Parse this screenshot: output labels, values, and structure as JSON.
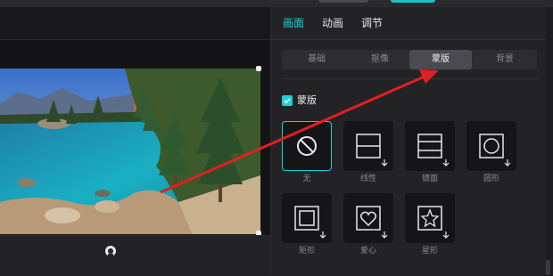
{
  "tabs": [
    {
      "label": "画面",
      "active": true
    },
    {
      "label": "动画",
      "active": false
    },
    {
      "label": "调节",
      "active": false
    }
  ],
  "subtabs": [
    {
      "label": "基础",
      "active": false
    },
    {
      "label": "抠像",
      "active": false
    },
    {
      "label": "蒙版",
      "active": true
    },
    {
      "label": "背景",
      "active": false
    }
  ],
  "mask_section": {
    "label": "蒙版",
    "checked": true
  },
  "masks": [
    {
      "label": "无",
      "icon": "none-icon",
      "selected": true
    },
    {
      "label": "线性",
      "icon": "linear-mask-icon",
      "selected": false
    },
    {
      "label": "镜面",
      "icon": "mirror-mask-icon",
      "selected": false
    },
    {
      "label": "圆形",
      "icon": "circle-mask-icon",
      "selected": false
    },
    {
      "label": "矩形",
      "icon": "rectangle-mask-icon",
      "selected": false
    },
    {
      "label": "爱心",
      "icon": "heart-mask-icon",
      "selected": false
    },
    {
      "label": "星形",
      "icon": "star-mask-icon",
      "selected": false
    }
  ],
  "colors": {
    "accent": "#1fd0d6",
    "annotation_arrow": "#e02020"
  }
}
